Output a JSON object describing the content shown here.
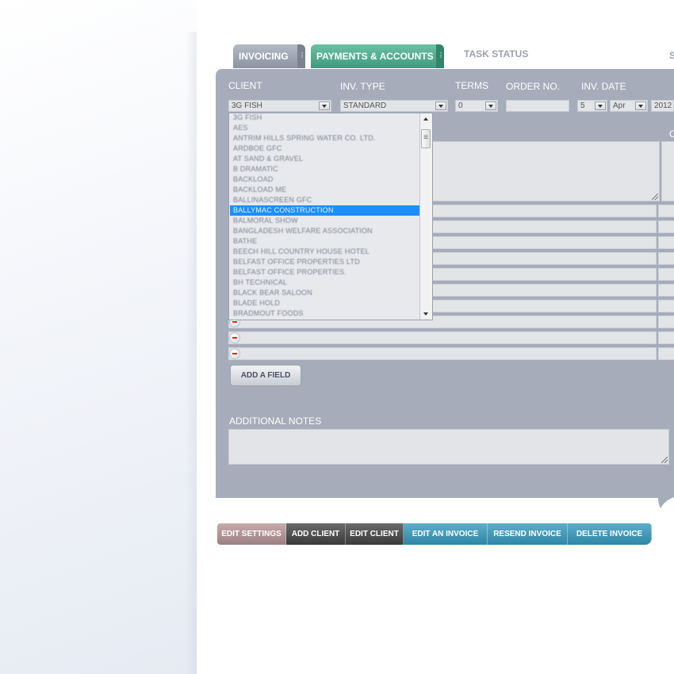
{
  "tabs": {
    "invoicing": "INVOICING",
    "payments": "PAYMENTS & ACCOUNTS",
    "task_status": "TASK STATUS",
    "cut": "S"
  },
  "form": {
    "client_label": "CLIENT",
    "client_value": "3G FISH",
    "inv_type_label": "INV. TYPE",
    "inv_type_value": "STANDARD",
    "terms_label": "TERMS",
    "terms_value": "0",
    "order_no_label": "ORDER NO.",
    "order_no_value": "",
    "inv_date_label": "INV. DATE",
    "inv_date_day": "5",
    "inv_date_month": "Apr",
    "inv_date_year": "2012",
    "col_cut": "C"
  },
  "client_list": {
    "items": [
      "3G FISH",
      "AES",
      "ANTRIM HILLS SPRING WATER CO. LTD.",
      "ARDBOE GFC",
      "AT SAND & GRAVEL",
      "B DRAMATIC",
      "BACKLOAD",
      "BACKLOAD ME",
      "BALLINASCREEN GFC",
      "BALLYMAC CONSTRUCTION",
      "BALMORAL SHOW",
      "BANGLADESH WELFARE ASSOCIATION",
      "BATHE",
      "BEECH HILL COUNTRY HOUSE HOTEL",
      "BELFAST OFFICE PROPERTIES LTD",
      "BELFAST OFFICE PROPERTIES.",
      "BH TECHNICAL",
      "BLACK BEAR SALOON",
      "BLADE HOLD",
      "BRADMOUT FOODS"
    ],
    "selected": "BALLYMAC CONSTRUCTION"
  },
  "buttons": {
    "add_field": "ADD A FIELD"
  },
  "notes": {
    "label": "ADDITIONAL NOTES",
    "value": ""
  },
  "bottom_bar": {
    "edit_settings": "EDIT SETTINGS",
    "add_client": "ADD CLIENT",
    "edit_client": "EDIT CLIENT",
    "edit_invoice": "EDIT AN INVOICE",
    "resend_invoice": "RESEND INVOICE",
    "delete_invoice": "DELETE INVOICE"
  },
  "colors": {
    "panel": "#a6acba",
    "payments_tab": "#3f9a7e",
    "selection": "#1a8fff",
    "delete_icon": "#d4282c"
  }
}
